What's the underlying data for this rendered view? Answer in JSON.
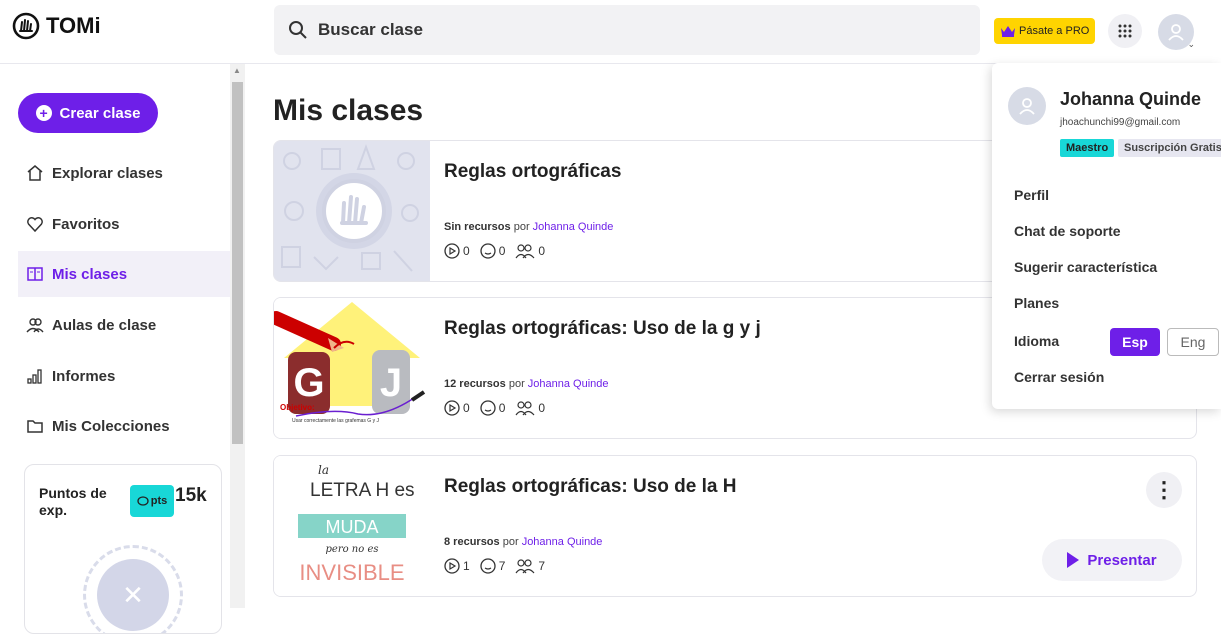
{
  "app": {
    "name": "TOMi"
  },
  "search": {
    "placeholder": "Buscar clase"
  },
  "header": {
    "pro_label": "Pásate a PRO"
  },
  "sidebar": {
    "create_label": "Crear clase",
    "items": [
      {
        "label": "Explorar clases",
        "icon": "home-icon"
      },
      {
        "label": "Favoritos",
        "icon": "heart-icon"
      },
      {
        "label": "Mis clases",
        "icon": "book-icon",
        "active": true
      },
      {
        "label": "Aulas de clase",
        "icon": "users-icon"
      },
      {
        "label": "Informes",
        "icon": "bar-chart-icon"
      },
      {
        "label": "Mis Colecciones",
        "icon": "folder-icon"
      }
    ],
    "points": {
      "label": "Puntos de exp.",
      "badge": "pts",
      "value": "15k"
    }
  },
  "main": {
    "title": "Mis clases",
    "classes": [
      {
        "title": "Reglas ortográficas",
        "resources": "Sin recursos",
        "by_label": "por",
        "author": "Johanna Quinde",
        "plays": "0",
        "reactions": "0",
        "students": "0"
      },
      {
        "title": "Reglas ortográficas: Uso de la g y j",
        "resources": "12 recursos",
        "by_label": "por",
        "author": "Johanna Quinde",
        "plays": "0",
        "reactions": "0",
        "students": "0",
        "thumb_letters": "G J",
        "thumb_caption_title": "Objetivo:",
        "thumb_caption": "Usar correctamente las grafemas G y J"
      },
      {
        "title": "Reglas ortográficas: Uso de la H",
        "resources": "8 recursos",
        "by_label": "por",
        "author": "Johanna Quinde",
        "plays": "1",
        "reactions": "7",
        "students": "7",
        "present_label": "Presentar",
        "thumb_lines": [
          "la",
          "LETRA H es",
          "MUDA",
          "pero no es",
          "INVISIBLE"
        ]
      }
    ]
  },
  "user_menu": {
    "name": "Johanna Quinde",
    "email": "jhoachunchi99@gmail.com",
    "role": "Maestro",
    "subscription": "Suscripción Gratis",
    "items": [
      "Perfil",
      "Chat de soporte",
      "Sugerir característica",
      "Planes"
    ],
    "language_label": "Idioma",
    "lang_esp": "Esp",
    "lang_eng": "Eng",
    "logout": "Cerrar sesión"
  },
  "colors": {
    "accent": "#6e1fe8",
    "teal": "#18d7d7",
    "pro": "#ffd400"
  }
}
